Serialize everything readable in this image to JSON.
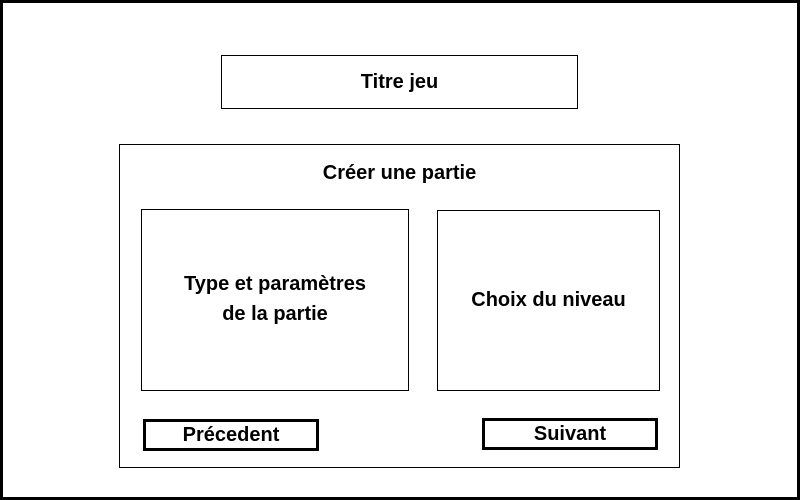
{
  "header": {
    "game_title": "Titre jeu"
  },
  "create_game": {
    "heading": "Créer une partie",
    "type_panel": {
      "label": "Type et paramètres\nde la partie"
    },
    "level_panel": {
      "label": "Choix du niveau"
    },
    "buttons": {
      "previous_label": "Précedent",
      "next_label": "Suivant"
    }
  },
  "colors": {
    "border": "#000000",
    "background": "#ffffff",
    "text": "#000000"
  }
}
